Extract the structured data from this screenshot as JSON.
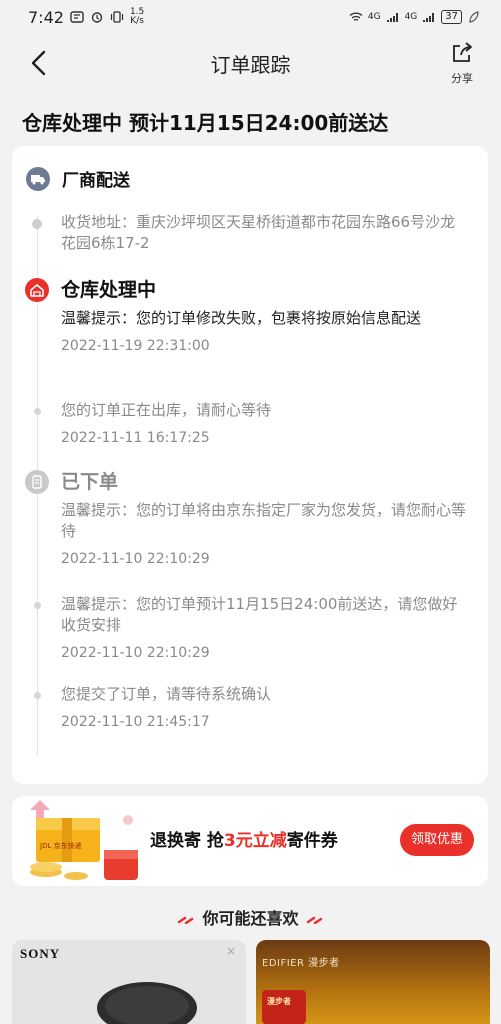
{
  "status_bar": {
    "time": "7:42",
    "speed_value": "1.5",
    "speed_unit": "K/s",
    "net1": "4G",
    "net2": "4G",
    "battery": "37"
  },
  "nav": {
    "title": "订单跟踪",
    "share_label": "分享"
  },
  "headline": "仓库处理中 预计11月15日24:00前送达",
  "card": {
    "carrier": "厂商配送",
    "address": "收货地址：重庆沙坪坝区天星桥街道都市花园东路66号沙龙花园6栋17-2",
    "events": [
      {
        "status": "仓库处理中",
        "text": "温馨提示：您的订单修改失败，包裹将按原始信息配送",
        "time": "2022-11-19 22:31:00"
      },
      {
        "text": "您的订单正在出库，请耐心等待",
        "time": "2022-11-11 16:17:25"
      },
      {
        "status": "已下单",
        "text": "温馨提示：您的订单将由京东指定厂家为您发货，请您耐心等待",
        "time": "2022-11-10 22:10:29"
      },
      {
        "text": "温馨提示：您的订单预计11月15日24:00前送达，请您做好收货安排",
        "time": "2022-11-10 22:10:29"
      },
      {
        "text": "您提交了订单，请等待系统确认",
        "time": "2022-11-10 21:45:17"
      }
    ]
  },
  "promo": {
    "text_prefix": "退换寄 抢",
    "text_highlight": "3元立减",
    "text_suffix": "寄件券",
    "button": "领取优惠",
    "art_label": "JDL 京东快递"
  },
  "recommend": {
    "title": "你可能还喜欢",
    "products": [
      {
        "brand": "SONY",
        "close": "×"
      },
      {
        "brand": "EDIFIER 漫步者",
        "badge": "漫步者"
      }
    ]
  },
  "colors": {
    "accent": "#e9302a",
    "page_bg": "#f2f2f2",
    "muted_text": "#8a8a8a"
  }
}
